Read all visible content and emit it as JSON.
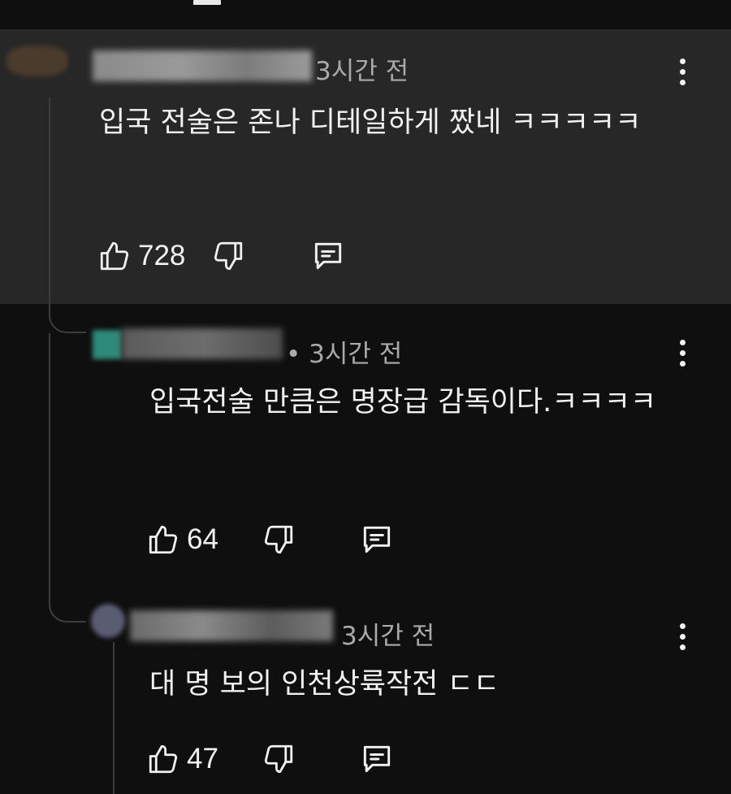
{
  "comments": [
    {
      "time": "3시간 전",
      "text": "입국 전술은 존나 디테일하게 짰네 ㅋㅋㅋㅋㅋ",
      "likes": "728",
      "highlighted": true
    },
    {
      "time": "• 3시간 전",
      "text": "입국전술 만큼은 명장급 감독이다.ㅋㅋㅋㅋ",
      "likes": "64"
    },
    {
      "time": "3시간 전",
      "text": "대 명 보의 인천상륙작전 ㄷㄷ",
      "likes": "47"
    }
  ],
  "icons": {
    "like": "thumb-up-icon",
    "dislike": "thumb-down-icon",
    "reply": "reply-comment-icon",
    "more": "more-vertical-icon"
  },
  "colors": {
    "background": "#0f0f0f",
    "highlight": "#272727",
    "text": "#f1f1f1",
    "meta": "#aaaaaa"
  }
}
